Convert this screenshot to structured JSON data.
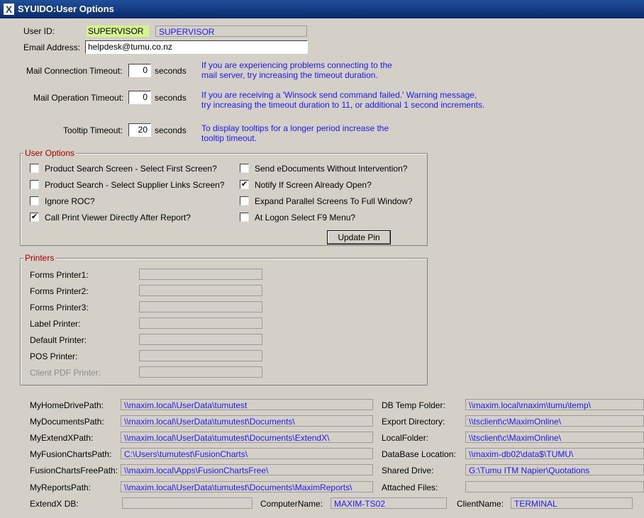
{
  "window": {
    "title": "SYUIDO:User Options",
    "icon": "app-x-icon"
  },
  "user": {
    "id_label": "User ID:",
    "id_value": "SUPERVISOR",
    "name_value": "SUPERVISOR",
    "email_label": "Email Address:",
    "email_value": "helpdesk@tumu.co.nz"
  },
  "timeouts": {
    "mail_connection_label": "Mail Connection Timeout:",
    "mail_connection_value": "0",
    "mail_connection_unit": "seconds",
    "mail_connection_hint_1": "If you are experiencing problems connecting to the",
    "mail_connection_hint_2": "mail server, try increasing the timeout duration.",
    "mail_operation_label": "Mail Operation Timeout:",
    "mail_operation_value": "0",
    "mail_operation_unit": "seconds",
    "mail_operation_hint_1": "If you are receiving a 'Winsock send command failed.' Warning message,",
    "mail_operation_hint_2": "try increasing the timeout duration to 11, or additional 1 second increments.",
    "tooltip_label": "Tooltip Timeout:",
    "tooltip_value": "20",
    "tooltip_unit": "seconds",
    "tooltip_hint_1": "To display tooltips for a longer period increase the",
    "tooltip_hint_2": "tooltip timeout."
  },
  "options": {
    "legend": "User Options",
    "left": [
      {
        "label": "Product Search Screen - Select First Screen?",
        "checked": false
      },
      {
        "label": "Product Search - Select Supplier Links Screen?",
        "checked": false
      },
      {
        "label": "Ignore ROC?",
        "checked": false
      },
      {
        "label": "Call Print Viewer Directly After Report?",
        "checked": true
      }
    ],
    "right": [
      {
        "label": "Send eDocuments Without Intervention?",
        "checked": false
      },
      {
        "label": "Notify If Screen Already Open?",
        "checked": true
      },
      {
        "label": "Expand Parallel Screens To Full Window?",
        "checked": false
      },
      {
        "label": "At Logon Select F9 Menu?",
        "checked": false
      }
    ],
    "update_pin_label": "Update Pin"
  },
  "printers": {
    "legend": "Printers",
    "items": [
      {
        "label": "Forms Printer1:",
        "value": "",
        "disabled": false
      },
      {
        "label": "Forms Printer2:",
        "value": "",
        "disabled": false
      },
      {
        "label": "Forms Printer3:",
        "value": "",
        "disabled": false
      },
      {
        "label": "Label Printer:",
        "value": "",
        "disabled": false
      },
      {
        "label": "Default Printer:",
        "value": "",
        "disabled": false
      },
      {
        "label": "POS Printer:",
        "value": "",
        "disabled": false
      },
      {
        "label": "Client PDF Printer:",
        "value": "",
        "disabled": true
      }
    ]
  },
  "paths": {
    "left": [
      {
        "label": "MyHomeDrivePath:",
        "value": "\\\\maxim.local\\UserData\\tumutest"
      },
      {
        "label": "MyDocumentsPath:",
        "value": "\\\\maxim.local\\UserData\\tumutest\\Documents\\"
      },
      {
        "label": "MyExtendXPath:",
        "value": "\\\\maxim.local\\UserData\\tumutest\\Documents\\ExtendX\\"
      },
      {
        "label": "MyFusionChartsPath:",
        "value": "C:\\Users\\tumutest\\FusionCharts\\"
      },
      {
        "label": "FusionChartsFreePath:",
        "value": "\\\\maxim.local\\Apps\\FusionChartsFree\\"
      },
      {
        "label": "MyReportsPath:",
        "value": "\\\\maxim.local\\UserData\\tumutest\\Documents\\MaximReports\\"
      }
    ],
    "right": [
      {
        "label": "DB Temp Folder:",
        "value": "\\\\maxim.local\\maxim\\tumu\\temp\\"
      },
      {
        "label": "Export Directory:",
        "value": "\\\\tsclient\\c\\MaximOnline\\"
      },
      {
        "label": "LocalFolder:",
        "value": "\\\\tsclient\\c\\MaximOnline\\"
      },
      {
        "label": "DataBase Location:",
        "value": "\\\\maxim-db02\\data$\\TUMU\\"
      },
      {
        "label": "Shared Drive:",
        "value": "G:\\Tumu ITM Napier\\Quotations"
      },
      {
        "label": "Attached Files:",
        "value": ""
      }
    ]
  },
  "footer": {
    "extendx_label": "ExtendX DB:",
    "extendx_value": "",
    "computer_label": "ComputerName:",
    "computer_value": "MAXIM-TS02",
    "client_label": "ClientName:",
    "client_value": "TERMINAL"
  }
}
